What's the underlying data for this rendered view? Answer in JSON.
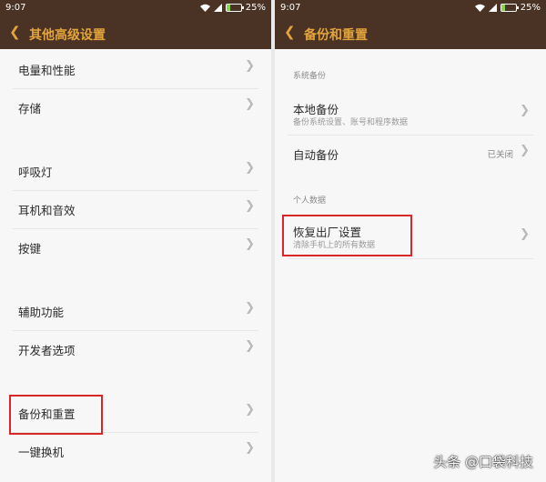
{
  "status_bar": {
    "time": "9:07",
    "battery": "25%",
    "battery_level": 0.25
  },
  "left": {
    "title": "其他高级设置",
    "items": [
      "电量和性能",
      "存储",
      "呼吸灯",
      "耳机和音效",
      "按键",
      "辅助功能",
      "开发者选项",
      "备份和重置",
      "一键换机"
    ]
  },
  "right": {
    "title": "备份和重置",
    "section_system": "系统备份",
    "local_backup": {
      "title": "本地备份",
      "subtitle": "备份系统设置、账号和程序数据"
    },
    "auto_backup": {
      "title": "自动备份",
      "value": "已关闭"
    },
    "section_personal": "个人数据",
    "factory_reset": {
      "title": "恢复出厂设置",
      "subtitle": "清除手机上的所有数据"
    }
  },
  "watermark": "头条 @口袋科技",
  "colors": {
    "bar": "#4a3324",
    "accent": "#e3a43b",
    "highlight": "#d92727"
  },
  "icons": [
    "wifi-icon",
    "signal-icon",
    "battery-icon",
    "back-arrow-icon",
    "chevron-right-icon"
  ]
}
